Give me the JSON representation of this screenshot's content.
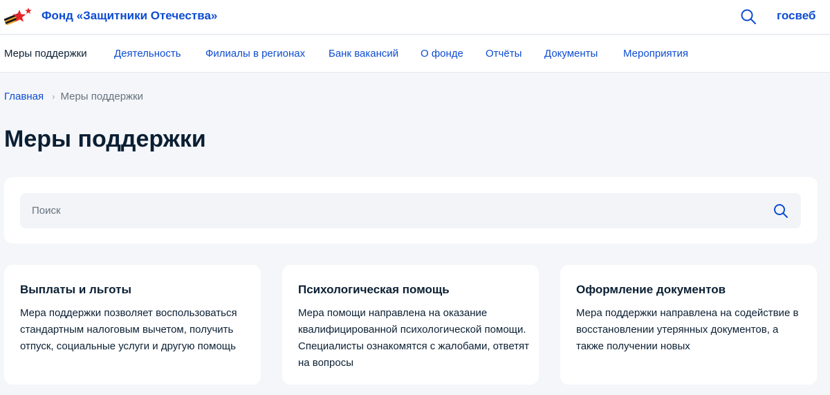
{
  "header": {
    "brand_name": "Фонд «Защитники Отечества»",
    "gosweb_label": "госвеб",
    "search_icon": "search-icon",
    "logo_icon": "ribbon-star-logo"
  },
  "nav": {
    "items": [
      {
        "label": "Меры поддержки",
        "active": true
      },
      {
        "label": "Деятельность"
      },
      {
        "label": "Филиалы в регионах"
      },
      {
        "label": "Банк вакансий"
      },
      {
        "label": "О фонде"
      },
      {
        "label": "Отчёты"
      },
      {
        "label": "Документы"
      },
      {
        "label": "Мероприятия"
      }
    ]
  },
  "breadcrumb": {
    "home": "Главная",
    "current": "Меры поддержки"
  },
  "page": {
    "title": "Меры поддержки"
  },
  "search": {
    "placeholder": "Поиск"
  },
  "cards": [
    {
      "title": "Выплаты и льготы",
      "text": "Мера поддержки позволяет воспользоваться стандартным налоговым вычетом, получить отпуск, социальные услуги и другую помощь"
    },
    {
      "title": "Психологическая помощь",
      "text": "Мера помощи направлена на оказание квалифицированной психологической помощи. Специалисты ознакомятся с жалобами, ответят на вопросы"
    },
    {
      "title": "Оформление документов",
      "text": "Мера поддержки направлена на содействие в восстановлении утерянных документов, а также получении новых"
    }
  ],
  "colors": {
    "accent": "#0d4cd3",
    "text": "#0b1f33",
    "background": "#f4f6f9",
    "ribbon_orange": "#f5a623",
    "star_red": "#e5242a"
  }
}
